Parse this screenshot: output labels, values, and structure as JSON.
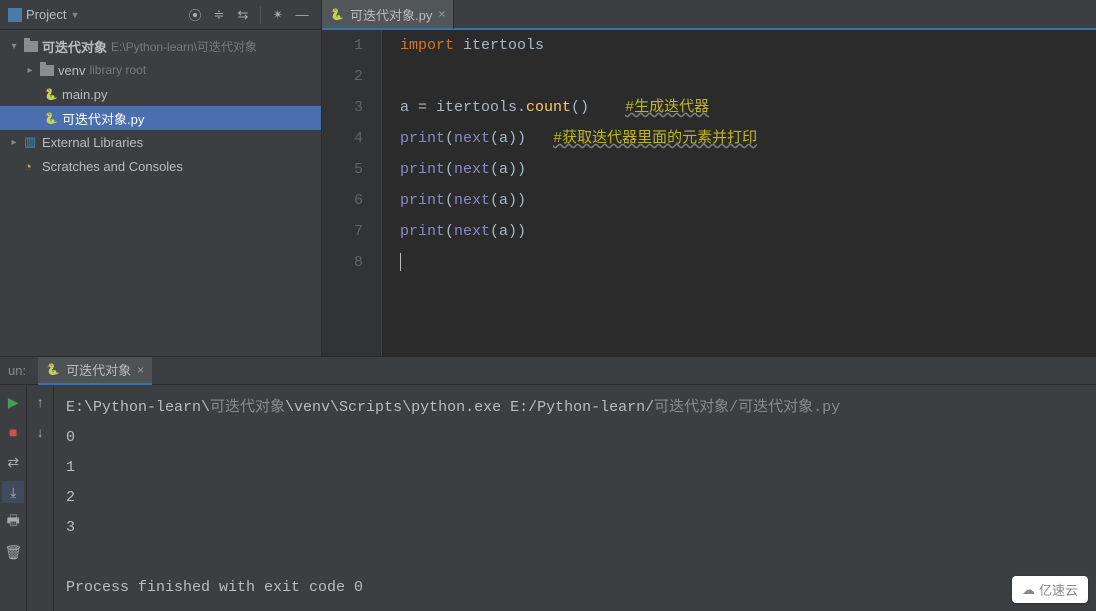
{
  "sidebar": {
    "title": "Project",
    "project": {
      "name": "可迭代对象",
      "path": "E:\\Python-learn\\可迭代对象"
    },
    "venv": {
      "name": "venv",
      "note": "library root"
    },
    "files": [
      {
        "name": "main.py"
      },
      {
        "name": "可迭代对象.py"
      }
    ],
    "externalLibs": "External Libraries",
    "scratches": "Scratches and Consoles"
  },
  "editor": {
    "tab": {
      "name": "可迭代对象.py"
    },
    "lineNumbers": [
      "1",
      "2",
      "3",
      "4",
      "5",
      "6",
      "7",
      "8"
    ],
    "code": {
      "l1_import": "import",
      "l1_mod": " itertools",
      "l3_pre": "a = itertools.",
      "l3_fn": "count",
      "l3_post": "()",
      "l3_comment": "#生成迭代器",
      "l4_fn": "print",
      "l4_open": "(",
      "l4_next": "next",
      "l4_args": "(a))",
      "l4_comment": "#获取迭代器里面的元素并打印",
      "l5_fn": "print",
      "l5_open": "(",
      "l5_next": "next",
      "l5_args": "(a))",
      "l6_fn": "print",
      "l6_open": "(",
      "l6_next": "next",
      "l6_args": "(a))",
      "l7_fn": "print",
      "l7_open": "(",
      "l7_next": "next",
      "l7_args": "(a))"
    }
  },
  "run": {
    "label": "un:",
    "tab": "可迭代对象",
    "output": {
      "cmd_prefix": "E:\\Python-learn\\",
      "cmd_cn1": "可迭代对象",
      "cmd_mid": "\\venv\\Scripts\\python.exe E:/Python-learn/",
      "cmd_cn2": "可迭代对象",
      "cmd_slash": "/",
      "cmd_file": "可迭代对象.py",
      "lines": [
        "0",
        "1",
        "2",
        "3"
      ],
      "exit": "Process finished with exit code 0"
    }
  },
  "watermark": "亿速云"
}
